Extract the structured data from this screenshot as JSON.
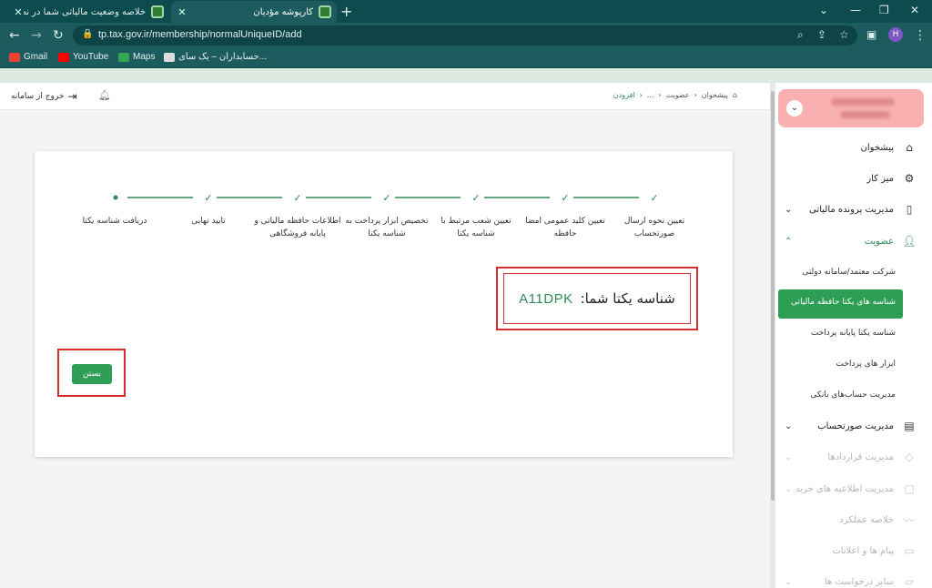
{
  "browser": {
    "tabs": [
      {
        "title": "خلاصه وضعیت مالیاتی شما در نظا",
        "active": false
      },
      {
        "title": "کارپوشه مؤدیان",
        "active": true
      }
    ],
    "url": "tp.tax.gov.ir/membership/normalUniqueID/add",
    "profile_initial": "H",
    "bookmarks": [
      {
        "label": "Gmail",
        "icon": "gmail-icon",
        "color": "#ea4335"
      },
      {
        "label": "YouTube",
        "icon": "youtube-icon",
        "color": "#ff0000"
      },
      {
        "label": "Maps",
        "icon": "maps-icon",
        "color": "#34a853"
      },
      {
        "label": "حسابداران – یک سای...",
        "icon": "site-icon",
        "color": "#cccccc"
      }
    ]
  },
  "topbar": {
    "logout_label": "خروج از سامانه",
    "breadcrumbs": [
      "پیشخوان",
      "عضویت",
      "...",
      "افزودن"
    ]
  },
  "stepper": {
    "steps": [
      {
        "label": "تعیین نحوه ارسال صورتحساب",
        "status": "done"
      },
      {
        "label": "تعیین کلید عمومی امضا حافظه",
        "status": "done"
      },
      {
        "label": "تعیین شعب مرتبط با شناسه یکتا",
        "status": "done"
      },
      {
        "label": "تخصیص ابزار پرداخت به شناسه یکتا",
        "status": "done"
      },
      {
        "label": "اطلاعات حافظه مالیاتی و پایانه فروشگاهی",
        "status": "done"
      },
      {
        "label": "تایید نهایی",
        "status": "done"
      },
      {
        "label": "دریافت شناسه یکتا",
        "status": "current"
      }
    ],
    "accent_color": "#2e8b57"
  },
  "result": {
    "label": "شناسه یکتا شما:",
    "unique_id": "A11DPK",
    "close_label": "بستن"
  },
  "sidebar": {
    "items": [
      {
        "label": "پیشخوان",
        "icon": "home-icon",
        "state": "normal"
      },
      {
        "label": "میز کار",
        "icon": "workspace-icon",
        "state": "normal"
      },
      {
        "label": "مدیریت پرونده مالیاتی",
        "icon": "file-icon",
        "state": "normal",
        "chevron": "down"
      },
      {
        "label": "عضویت",
        "icon": "user-icon",
        "state": "expanded",
        "chevron": "up"
      },
      {
        "label": "مدیریت صورتحساب",
        "icon": "invoice-icon",
        "state": "normal",
        "chevron": "down"
      },
      {
        "label": "مدیریت قراردادها",
        "icon": "contract-icon",
        "state": "disabled",
        "chevron": "down"
      },
      {
        "label": "مدیریت اطلاعیه های خرید",
        "icon": "shopping-bag-icon",
        "state": "disabled",
        "chevron": "down"
      },
      {
        "label": "خلاصه عملکرد",
        "icon": "chart-icon",
        "state": "disabled"
      },
      {
        "label": "پیام ها و اعلانات",
        "icon": "message-icon",
        "state": "disabled"
      },
      {
        "label": "سایر درخواست ها",
        "icon": "request-icon",
        "state": "disabled",
        "chevron": "down"
      }
    ],
    "membership_subitems": [
      {
        "label": "شرکت معتمد/سامانه دولتی",
        "active": false
      },
      {
        "label": "شناسه های یکتا حافظه مالیاتی",
        "active": true
      },
      {
        "label": "شناسه یکتا پایانه پرداخت",
        "active": false
      },
      {
        "label": "ابزار های پرداخت",
        "active": false
      },
      {
        "label": "مدیریت حساب‌های بانکی",
        "active": false
      }
    ]
  }
}
